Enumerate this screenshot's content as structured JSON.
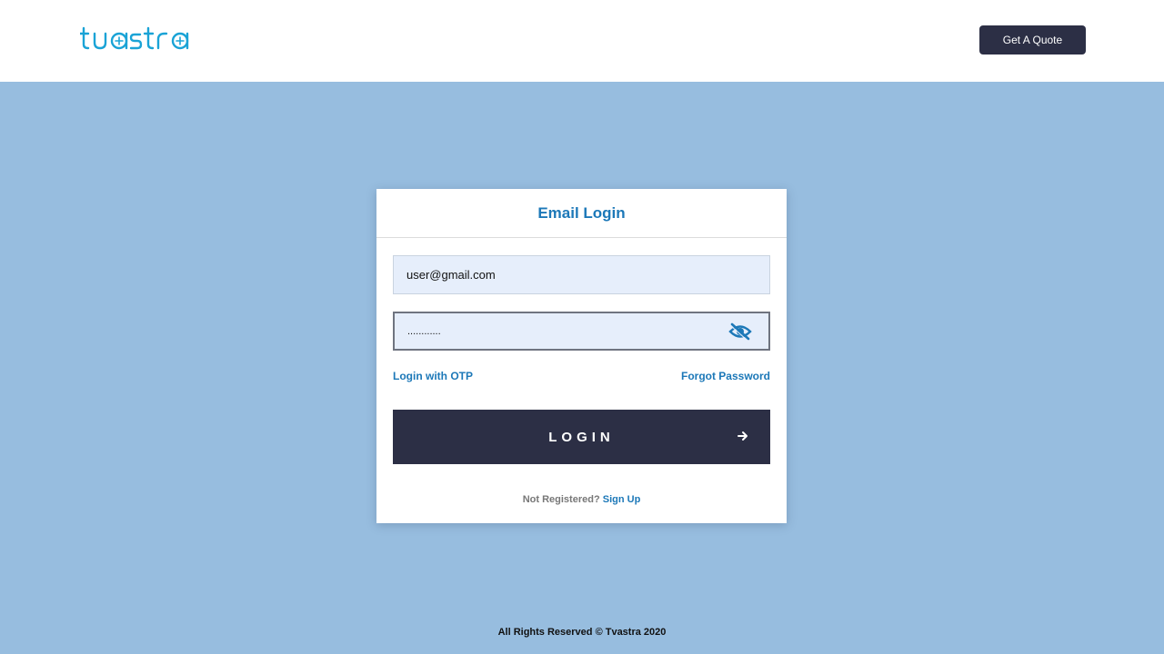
{
  "header": {
    "logo_text": "tvastra",
    "quote_button": "Get A Quote"
  },
  "login_card": {
    "title": "Email Login",
    "email_value": "user@gmail.com",
    "password_value": "............",
    "password_toggle_icon": "eye-slash-icon",
    "login_with_otp": "Login with OTP",
    "forgot_password": "Forgot Password",
    "login_button": "LOGIN",
    "login_arrow_icon": "arrow-right-icon",
    "not_registered": "Not Registered?",
    "sign_up": "Sign Up"
  },
  "footer": {
    "text": "All Rights Reserved © Tvastra 2020"
  },
  "colors": {
    "background": "#97bddf",
    "brand_dark": "#2c2f45",
    "link_blue": "#1c78b8",
    "logo_blue": "#1aa3d6",
    "input_bg": "#e6eefb"
  }
}
